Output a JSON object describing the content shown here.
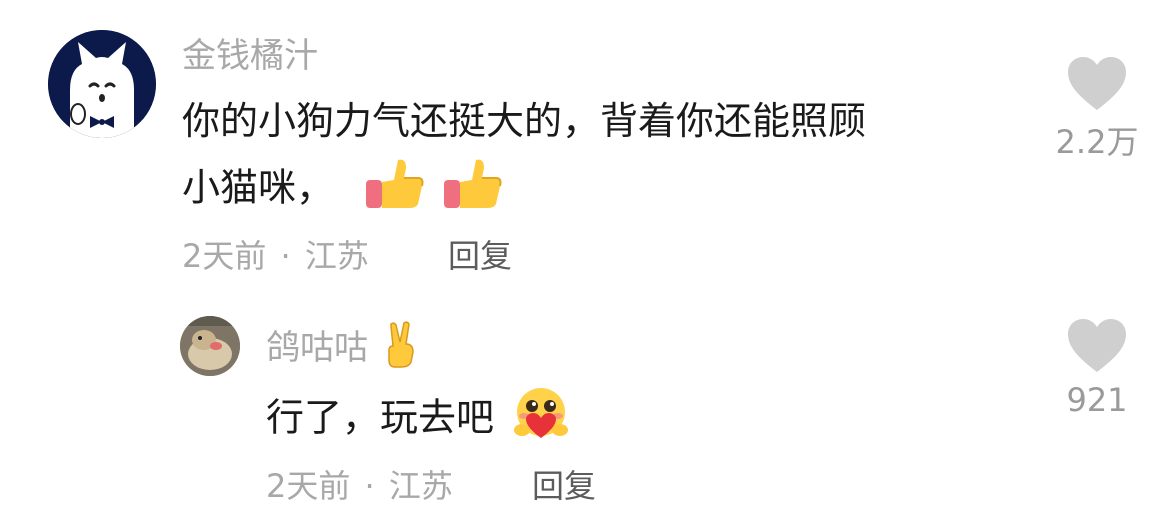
{
  "comments": [
    {
      "username": "金钱橘汁",
      "text_line1": "你的小狗力气还挺大的，背着你还能照顾",
      "text_line2": "小猫咪，",
      "emojis": [
        "thumbs-up-emoji",
        "thumbs-up-emoji"
      ],
      "time": "2天前",
      "separator": "·",
      "location": "江苏",
      "reply_label": "回复",
      "like_count": "2.2万",
      "avatar": "white-cat-avatar"
    },
    {
      "username": "鸽咕咕",
      "username_emoji": "victory-hand-emoji",
      "text": "行了，玩去吧",
      "emojis": [
        "hugging-heart-face-emoji"
      ],
      "time": "2天前",
      "separator": "·",
      "location": "江苏",
      "reply_label": "回复",
      "like_count": "921",
      "avatar": "dog-photo-avatar"
    }
  ],
  "colors": {
    "username": "#a8a8a8",
    "text": "#1a1a1a",
    "meta": "#a8a8a8",
    "reply": "#5c5c5c",
    "heart": "#cfcfcf",
    "like_count": "#9a9a9a"
  }
}
